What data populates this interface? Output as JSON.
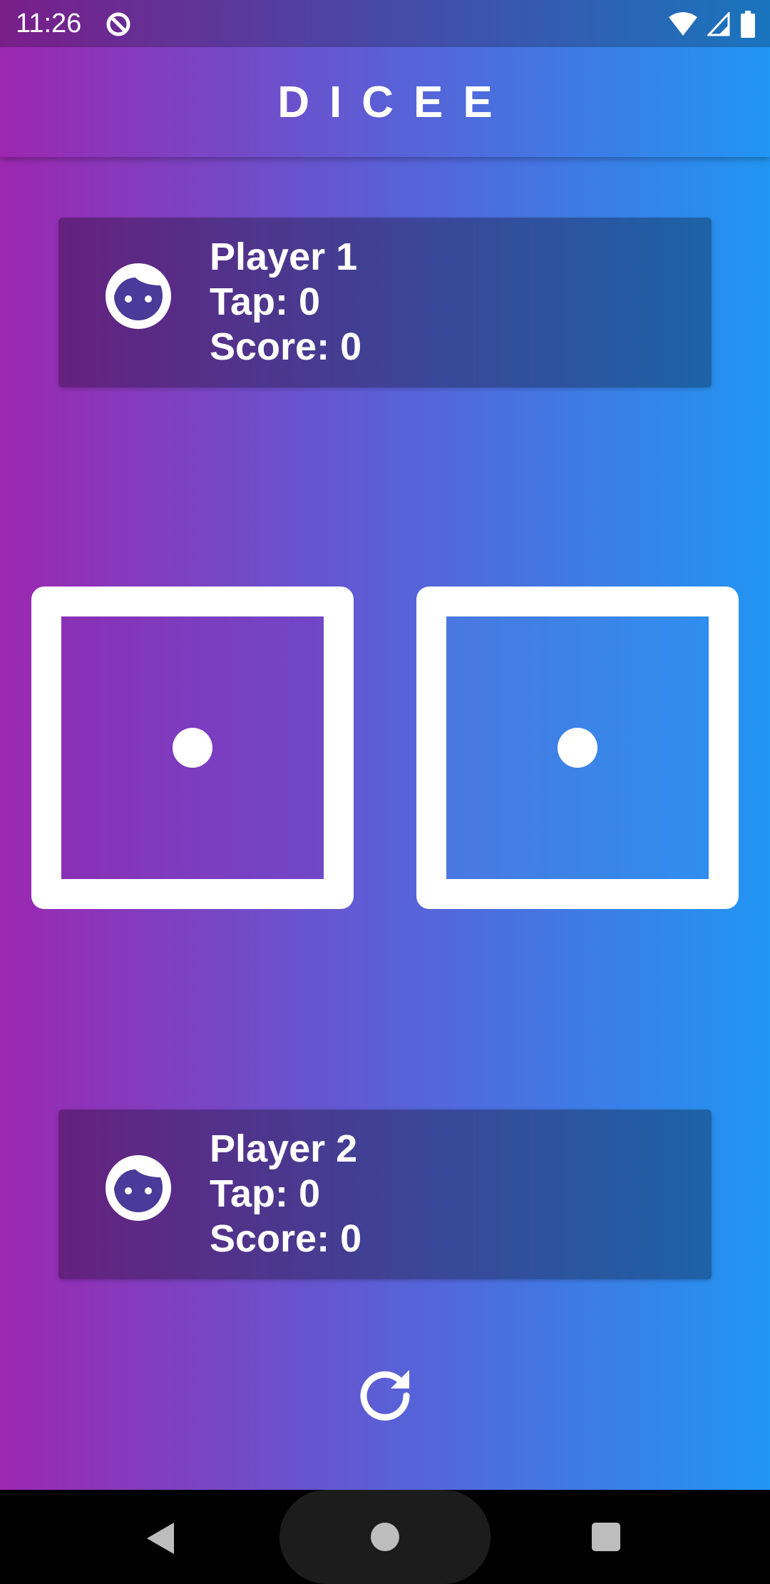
{
  "status_bar": {
    "time": "11:26",
    "left_icon": "vpn-key-icon",
    "right_icons": [
      "wifi-icon",
      "cellular-signal-icon",
      "battery-icon"
    ]
  },
  "app_bar": {
    "title": "DICEE"
  },
  "colors": {
    "gradient_start": "#9c27b0",
    "gradient_end": "#2196f3",
    "foreground": "#ffffff"
  },
  "players": [
    {
      "name": "Player 1",
      "tap_label": "Tap: 0",
      "score_label": "Score: 0",
      "icon": "face-icon"
    },
    {
      "name": "Player 2",
      "tap_label": "Tap: 0",
      "score_label": "Score: 0",
      "icon": "face-icon"
    }
  ],
  "dice": [
    {
      "value": 1
    },
    {
      "value": 1
    }
  ],
  "actions": {
    "refresh_icon": "refresh-icon"
  },
  "nav_bar": {
    "buttons": [
      "back-icon",
      "home-icon",
      "recents-icon"
    ]
  }
}
